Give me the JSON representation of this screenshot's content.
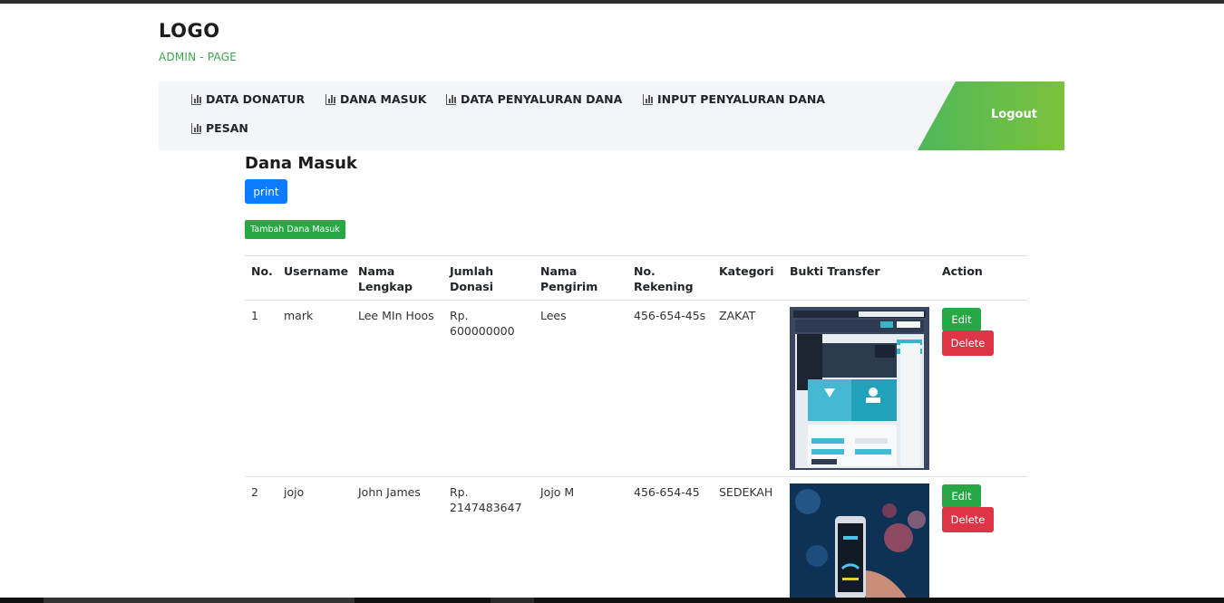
{
  "header": {
    "logo": "LOGO",
    "subtitle": "ADMIN - PAGE"
  },
  "nav": {
    "items": [
      {
        "label": "DATA DONATUR",
        "icon": "bar-chart-icon"
      },
      {
        "label": "DANA MASUK",
        "icon": "bar-chart-icon"
      },
      {
        "label": "DATA PENYALURAN DANA",
        "icon": "bar-chart-icon"
      },
      {
        "label": "INPUT PENYALURAN DANA",
        "icon": "bar-chart-icon"
      },
      {
        "label": "PESAN",
        "icon": "bar-chart-icon"
      }
    ],
    "logout_label": "Logout"
  },
  "main": {
    "title": "Dana Masuk",
    "print_label": "print",
    "add_label": "Tambah Dana Masuk"
  },
  "table": {
    "headers": {
      "no": "No.",
      "username": "Username",
      "nama_lengkap_1": "Nama",
      "nama_lengkap_2": "Lengkap",
      "jumlah_1": "Jumlah",
      "jumlah_2": "Donasi",
      "pengirim_1": "Nama",
      "pengirim_2": "Pengirim",
      "rekening_1": "No.",
      "rekening_2": "Rekening",
      "kategori": "Kategori",
      "bukti": "Bukti Transfer",
      "action": "Action"
    },
    "rows": [
      {
        "no": "1",
        "username": "mark",
        "nama_lengkap": "Lee MIn Hoos",
        "jumlah_1": "Rp.",
        "jumlah_2": "600000000",
        "pengirim": "Lees",
        "rekening": "456-654-45s",
        "kategori": "ZAKAT",
        "edit_label": "Edit",
        "delete_label": "Delete"
      },
      {
        "no": "2",
        "username": "jojo",
        "nama_lengkap": "John James",
        "jumlah_1": "Rp.",
        "jumlah_2": "2147483647",
        "pengirim": "Jojo M",
        "rekening": "456-654-45",
        "kategori": "SEDEKAH",
        "edit_label": "Edit",
        "delete_label": "Delete"
      }
    ]
  }
}
